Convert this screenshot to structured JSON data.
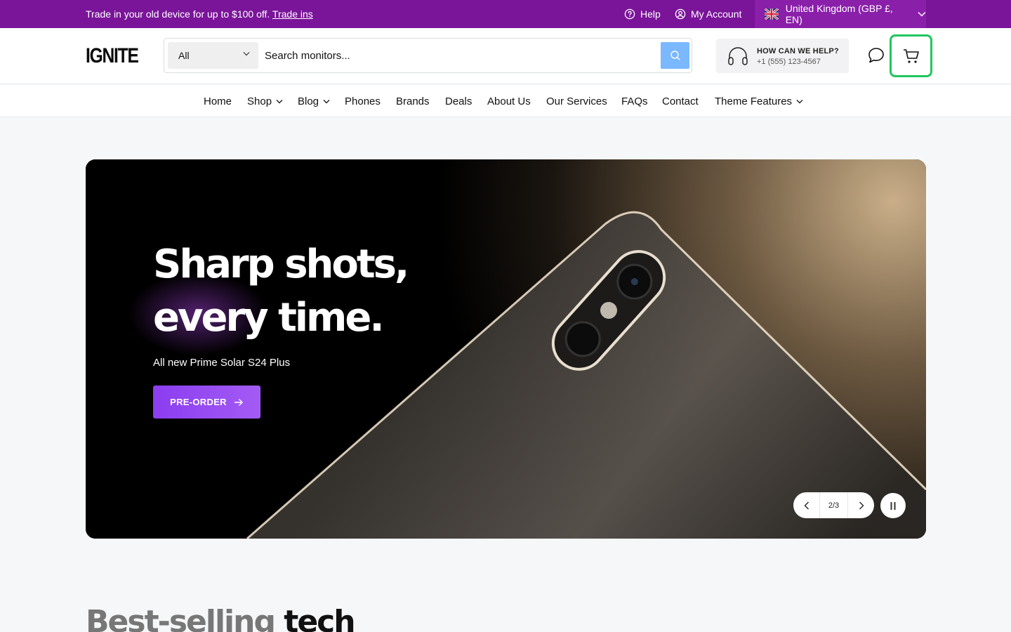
{
  "topbar": {
    "promo_text": "Trade in your old device for up to $100 off.",
    "promo_link": "Trade ins",
    "help": "Help",
    "account": "My Account",
    "locale": "United Kingdom (GBP £, EN)",
    "bg_color": "#7a1499"
  },
  "header": {
    "logo": "IGNITE",
    "search": {
      "category": "All",
      "placeholder": "Search monitors..."
    },
    "help_title": "HOW CAN WE HELP?",
    "help_phone": "+1 (555) 123-4567",
    "icons": [
      "chat-icon",
      "cart-icon"
    ],
    "cart_highlight_color": "#22c55e"
  },
  "nav": {
    "items": [
      {
        "label": "Home",
        "dropdown": false
      },
      {
        "label": "Shop",
        "dropdown": true
      },
      {
        "label": "Blog",
        "dropdown": true
      },
      {
        "label": "Phones",
        "dropdown": false
      },
      {
        "label": "Brands",
        "dropdown": false
      },
      {
        "label": "Deals",
        "dropdown": false
      },
      {
        "label": "About Us",
        "dropdown": false
      },
      {
        "label": "Our Services",
        "dropdown": false
      },
      {
        "label": "FAQs",
        "dropdown": false
      },
      {
        "label": "Contact",
        "dropdown": false
      },
      {
        "label": "Theme Features",
        "dropdown": true
      }
    ]
  },
  "hero": {
    "headline_1": "Sharp shots,",
    "headline_2": "every time.",
    "subtitle": "All new Prime Solar S24 Plus",
    "cta": "PRE-ORDER",
    "slide_counter": "2/3",
    "cta_color": "#8b3df0"
  },
  "section": {
    "title_muted": "Best-selling",
    "title_strong": "tech"
  }
}
